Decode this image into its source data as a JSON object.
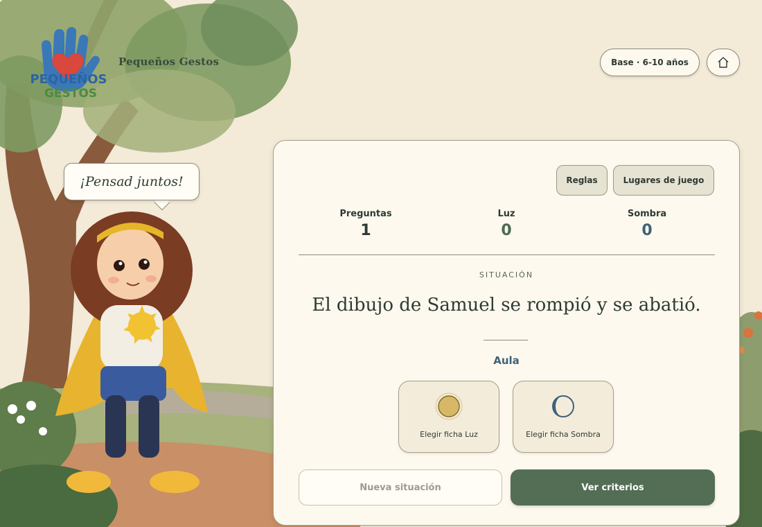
{
  "header": {
    "logo_text_top": "PEQUEÑOS",
    "logo_text_bottom": "GESTOS",
    "brand_name": "Pequeños Gestos",
    "age_badge": "Base · 6-10 años",
    "home_icon": "home-icon"
  },
  "mascot": {
    "speech": "¡Pensad juntos!"
  },
  "panel": {
    "rules_label": "Reglas",
    "places_label": "Lugares de juego",
    "stats": {
      "questions_label": "Preguntas",
      "questions_value": "1",
      "light_label": "Luz",
      "light_value": "0",
      "shadow_label": "Sombra",
      "shadow_value": "0"
    },
    "situation_label": "SITUACIÓN",
    "situation_text": "El dibujo de Samuel se rompió y se abatió.",
    "place": "Aula",
    "token_light_label": "Elegir ficha Luz",
    "token_shadow_label": "Elegir ficha Sombra",
    "new_situation_label": "Nueva situación",
    "criteria_label": "Ver criterios"
  },
  "colors": {
    "background": "#f3ead8",
    "primary_green": "#536e55",
    "light_value": "#4c6a50",
    "shadow_value": "#3e627a",
    "sun_token": "#d6b866",
    "moon_token": "#3e627a"
  }
}
